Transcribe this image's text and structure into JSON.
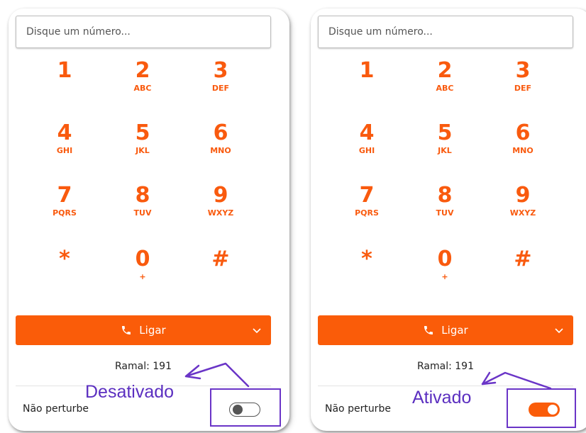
{
  "colors": {
    "accent": "#fa5c09",
    "annotation": "#6a35c7"
  },
  "panels": [
    {
      "search": {
        "placeholder": "Disque um número..."
      },
      "keys": [
        {
          "digit": "1",
          "letters": ""
        },
        {
          "digit": "2",
          "letters": "ABC"
        },
        {
          "digit": "3",
          "letters": "DEF"
        },
        {
          "digit": "4",
          "letters": "GHI"
        },
        {
          "digit": "5",
          "letters": "JKL"
        },
        {
          "digit": "6",
          "letters": "MNO"
        },
        {
          "digit": "7",
          "letters": "PQRS"
        },
        {
          "digit": "8",
          "letters": "TUV"
        },
        {
          "digit": "9",
          "letters": "WXYZ"
        },
        {
          "digit": "*",
          "letters": ""
        },
        {
          "digit": "0",
          "letters": "+"
        },
        {
          "digit": "#",
          "letters": ""
        }
      ],
      "call_label": "Ligar",
      "call_icon": "phone-icon",
      "menu_icon": "chevron-down-icon",
      "extension": "Ramal: 191",
      "dnd_label": "Não perturbe",
      "dnd_on": false,
      "annotation": "Desativado"
    },
    {
      "search": {
        "placeholder": "Disque um número..."
      },
      "keys": [
        {
          "digit": "1",
          "letters": ""
        },
        {
          "digit": "2",
          "letters": "ABC"
        },
        {
          "digit": "3",
          "letters": "DEF"
        },
        {
          "digit": "4",
          "letters": "GHI"
        },
        {
          "digit": "5",
          "letters": "JKL"
        },
        {
          "digit": "6",
          "letters": "MNO"
        },
        {
          "digit": "7",
          "letters": "PQRS"
        },
        {
          "digit": "8",
          "letters": "TUV"
        },
        {
          "digit": "9",
          "letters": "WXYZ"
        },
        {
          "digit": "*",
          "letters": ""
        },
        {
          "digit": "0",
          "letters": "+"
        },
        {
          "digit": "#",
          "letters": ""
        }
      ],
      "call_label": "Ligar",
      "call_icon": "phone-icon",
      "menu_icon": "chevron-down-icon",
      "extension": "Ramal: 191",
      "dnd_label": "Não perturbe",
      "dnd_on": true,
      "annotation": "Ativado"
    }
  ]
}
